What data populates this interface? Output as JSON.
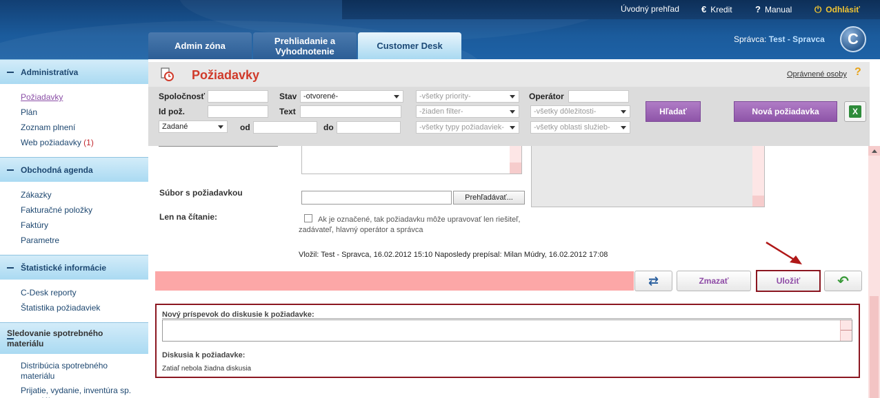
{
  "header": {
    "top_links": [
      {
        "label": "Úvodný prehľad",
        "icon": ""
      },
      {
        "label": "Kredit",
        "icon": "euro-icon"
      },
      {
        "label": "Manual",
        "icon": "question-icon"
      },
      {
        "label": "Odhlásiť",
        "icon": "power-icon"
      }
    ],
    "tabs": [
      {
        "label": "Admin zóna"
      },
      {
        "label": "Prehliadanie a Vyhodnotenie"
      },
      {
        "label": "Customer Desk"
      }
    ],
    "user_prefix": "Správca:",
    "user_name": "Test - Spravca",
    "logo_letter": "C"
  },
  "sidebar": {
    "sections": [
      {
        "title": "Administratíva",
        "items": [
          {
            "label": "Požiadavky"
          },
          {
            "label": "Plán"
          },
          {
            "label": "Zoznam plnení"
          },
          {
            "label": "Web požiadavky",
            "count": "(1)"
          }
        ]
      },
      {
        "title": "Obchodná agenda",
        "items": [
          {
            "label": "Zákazky"
          },
          {
            "label": "Fakturačné položky"
          },
          {
            "label": "Faktúry"
          },
          {
            "label": "Parametre"
          }
        ]
      },
      {
        "title": "Štatistické informácie",
        "items": [
          {
            "label": "C-Desk reporty"
          },
          {
            "label": "Štatistika požiadaviek"
          }
        ]
      },
      {
        "title": "Sledovanie spotrebného materiálu",
        "items": [
          {
            "label": "Distribúcia spotrebného materiálu"
          },
          {
            "label": "Prijatie, vydanie, inventúra sp. materiálu"
          }
        ]
      }
    ]
  },
  "main": {
    "title": "Požiadavky",
    "authorized_link": "Oprávnené osoby",
    "help": "?",
    "filters": {
      "company_label": "Spoločnosť",
      "status_label": "Stav",
      "status_value": "-otvorené-",
      "priority_value": "-všetky priority-",
      "operator_label": "Operátor",
      "id_label": "Id pož.",
      "text_label": "Text",
      "filter_value": "-žiaden filter-",
      "importance_value": "-všetky dôležitosti-",
      "date_type_value": "Zadané",
      "from_label": "od",
      "to_label": "do",
      "type_value": "-všetky typy požiadaviek-",
      "area_value": "-všetky oblasti služieb-",
      "search_button": "Hľadať",
      "new_button": "Nová požiadavka",
      "excel": "X"
    },
    "form": {
      "file_label": "Súbor s požiadavkou",
      "browse_button": "Prehľadávať...",
      "readonly_label": "Len na čítanie:",
      "readonly_text": "Ak je označené, tak požiadavku môže upravovať len riešiteľ, zadávateľ, hlavný operátor a správca",
      "meta": "Vložil: Test - Spravca, 16.02.2012 15:10   Naposledy prepísal: Milan Múdry, 16.02.2012 17:08",
      "delete_button": "Zmazať",
      "save_button": "Uložiť"
    },
    "discussion": {
      "new_label": "Nový príspevok do diskusie k požiadavke:",
      "list_label": "Diskusia k požiadavke:",
      "empty_text": "Zatiaľ nebola žiadna diskusia"
    }
  }
}
